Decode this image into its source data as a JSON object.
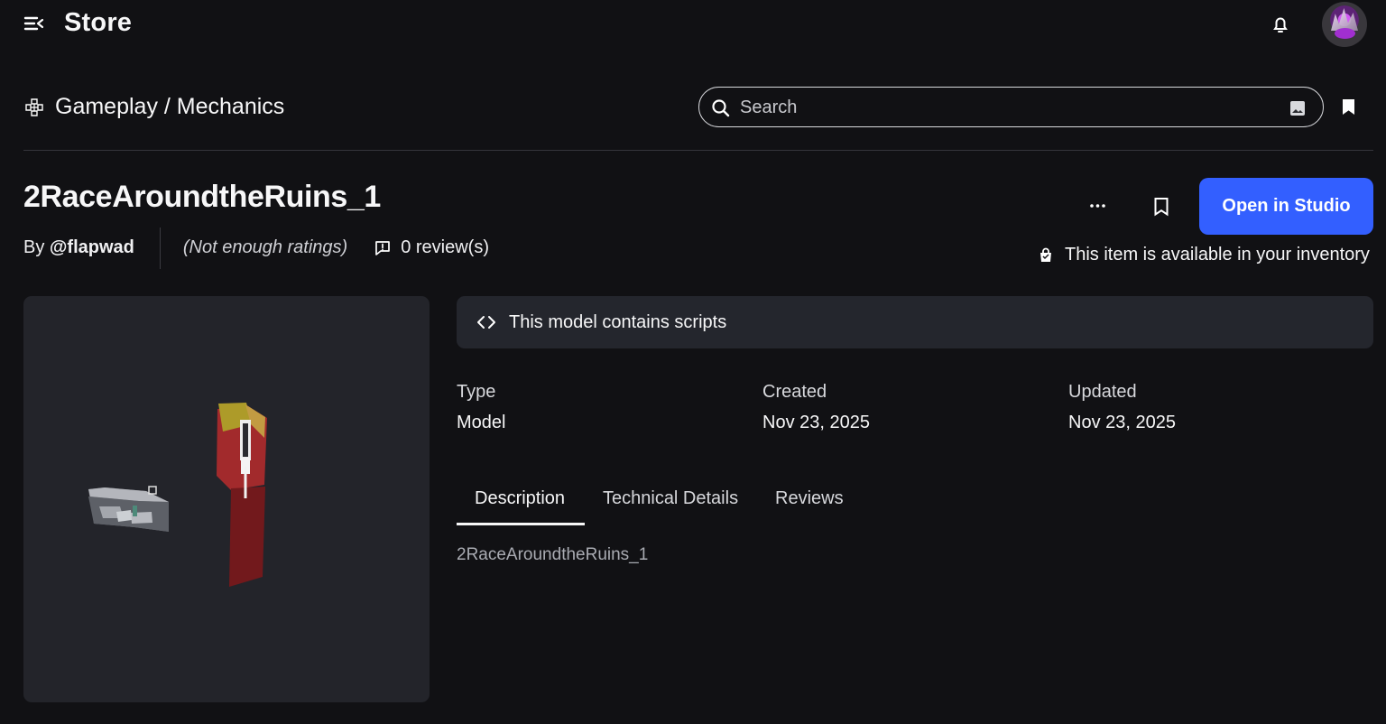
{
  "app": {
    "title": "Store"
  },
  "colors": {
    "background": "#111114",
    "panel": "#24262d",
    "accent": "#335fff",
    "text": "#f7f7f8"
  },
  "icons": {
    "menu": "menu-collapse-icon",
    "notifications": "bell-icon",
    "category": "gamepad-icon",
    "search": "search-icon",
    "image_search": "image-icon",
    "saved": "bookmark-icon",
    "more": "more-horizontal-icon",
    "reviews": "review-icon",
    "inventory": "shopping-bag-icon",
    "scripts": "code-icon"
  },
  "breadcrumb": {
    "text": "Gameplay / Mechanics"
  },
  "search": {
    "placeholder": "Search",
    "value": ""
  },
  "item": {
    "title": "2RaceAroundtheRuins_1",
    "creator_prefix": "By",
    "creator": "@flapwad",
    "ratings": "(Not enough ratings)",
    "reviews": "0 review(s)",
    "open_button": "Open in Studio",
    "inventory_message": "This item is available in your inventory",
    "scripts_notice": "This model contains scripts"
  },
  "details": [
    {
      "label": "Type",
      "value": "Model"
    },
    {
      "label": "Created",
      "value": "Nov 23, 2025"
    },
    {
      "label": "Updated",
      "value": "Nov 23, 2025"
    }
  ],
  "tabs": [
    {
      "label": "Description",
      "selected": true
    },
    {
      "label": "Technical Details",
      "selected": false
    },
    {
      "label": "Reviews",
      "selected": false
    }
  ],
  "description": "2RaceAroundtheRuins_1"
}
